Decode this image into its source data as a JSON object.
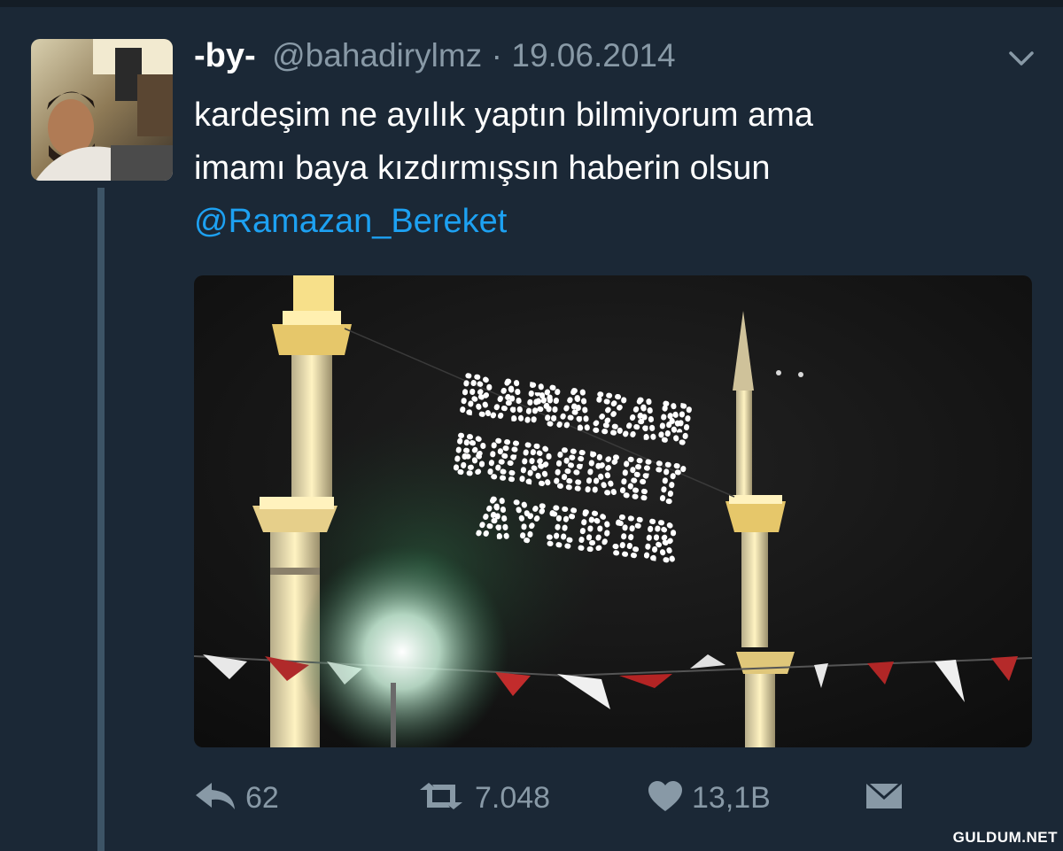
{
  "tweet": {
    "display_name": "-by-",
    "handle": "@bahadirylmz",
    "separator": "·",
    "date": "19.06.2014",
    "text_line_1": "kardeşim ne ayılık yaptın bilmiyorum ama",
    "text_line_2": "imamı baya kızdırmışsın haberin olsun",
    "mention": "@Ramazan_Bereket"
  },
  "media": {
    "sign_line_1": "RAMAZAN",
    "sign_line_2": "BEREKET",
    "sign_line_3": "AYIDIR"
  },
  "actions": {
    "reply_icon": "reply-icon",
    "reply_count": "62",
    "retweet_icon": "retweet-icon",
    "retweet_count": "7.048",
    "like_icon": "heart-icon",
    "like_count": "13,1B",
    "dm_icon": "envelope-icon"
  },
  "watermark": "GULDUM.NET",
  "colors": {
    "background": "#1b2836",
    "text": "#ffffff",
    "muted": "#8899a6",
    "link": "#1da1f2",
    "thread_line": "#3d5466"
  }
}
